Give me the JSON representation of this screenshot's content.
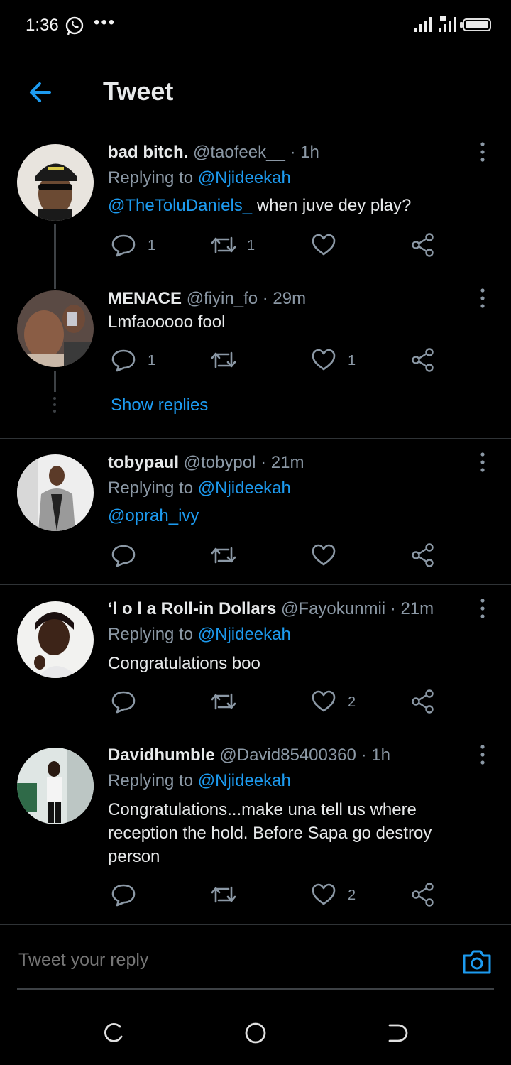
{
  "status_bar": {
    "time": "1:36"
  },
  "header": {
    "title": "Tweet"
  },
  "tweets": [
    {
      "name": "bad bitch.",
      "handle": "@taofeek__",
      "time": "· 1h",
      "replying_prefix": "Replying to",
      "replying_to": "@Njideekah",
      "mention": "@TheToluDaniels_",
      "text": " when juve dey play?",
      "reply_count": "1",
      "retweet_count": "1",
      "like_count": ""
    },
    {
      "name": "MENACE",
      "handle": "@fiyin_fo",
      "time": "· 29m",
      "text": "Lmfaooooo fool",
      "reply_count": "1",
      "retweet_count": "",
      "like_count": "1",
      "show_replies": "Show replies"
    },
    {
      "name": "tobypaul",
      "handle": "@tobypol",
      "time": "· 21m",
      "replying_prefix": "Replying to",
      "replying_to": "@Njideekah",
      "mention": "@oprah_ivy",
      "text": "",
      "reply_count": "",
      "retweet_count": "",
      "like_count": ""
    },
    {
      "name": "‘l o l a Roll-in Dollars⁣",
      "handle": "@Fayokunmii",
      "time": "· 21m",
      "replying_prefix": "Replying to",
      "replying_to": "@Njideekah",
      "text": "Congratulations boo",
      "reply_count": "",
      "retweet_count": "",
      "like_count": "2"
    },
    {
      "name": "Davidhumble",
      "handle": "@David85400360",
      "time": "· 1h",
      "replying_prefix": "Replying to",
      "replying_to": "@Njideekah",
      "text_lines": [
        "Congratulations...make una tell us where",
        "reception the hold. Before Sapa go destroy",
        "person"
      ],
      "reply_count": "",
      "retweet_count": "",
      "like_count": "2"
    }
  ],
  "reply_bar": {
    "placeholder": "Tweet your reply"
  },
  "colors": {
    "accent": "#1d9bf0",
    "background": "#000000",
    "muted": "#8b98a5",
    "divider": "#2f3336"
  },
  "icons": [
    "whatsapp-icon",
    "back-arrow-icon",
    "more-vertical-icon",
    "reply-icon",
    "retweet-icon",
    "like-icon",
    "share-icon",
    "camera-icon"
  ]
}
